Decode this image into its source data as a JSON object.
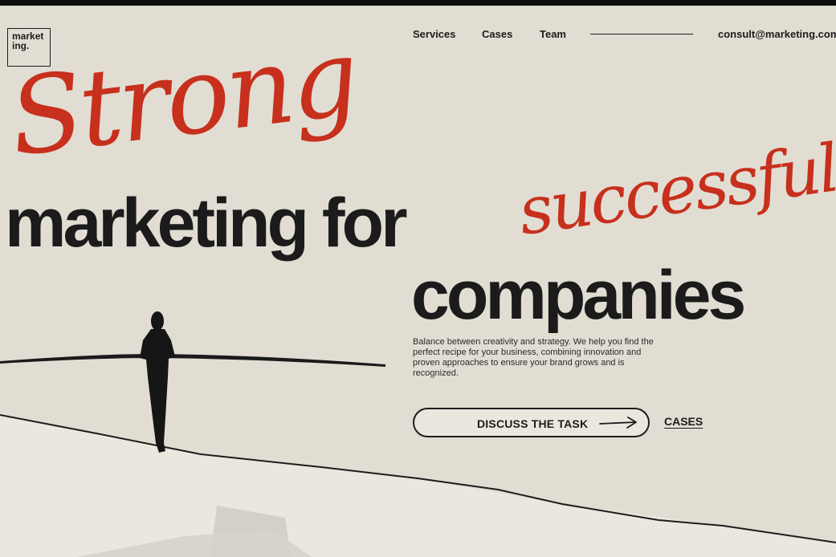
{
  "logo": {
    "line1": "market",
    "line2": "ing."
  },
  "nav": {
    "items": [
      {
        "label": "Services"
      },
      {
        "label": "Cases"
      },
      {
        "label": "Team"
      }
    ],
    "email": "consult@marketing.com"
  },
  "hero": {
    "script_top": "Strong",
    "headline_line1": "marketing for",
    "script_inline": "successful",
    "headline_line2": "companies",
    "description": "Balance between creativity and strategy. We help you find the perfect recipe for your business, combining innovation and proven approaches to ensure your brand grows and is recognized."
  },
  "cta": {
    "primary_label": "DISCUSS THE TASK",
    "secondary_label": "CASES"
  },
  "colors": {
    "background": "#e2ddd3",
    "accent": "#c7301c",
    "text": "#1c1c1c"
  }
}
